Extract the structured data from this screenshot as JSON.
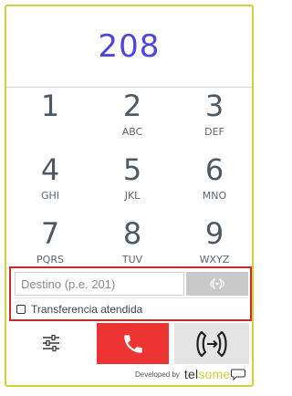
{
  "display": {
    "number": "208"
  },
  "keypad": [
    {
      "digit": "1",
      "letters": ""
    },
    {
      "digit": "2",
      "letters": "ABC"
    },
    {
      "digit": "3",
      "letters": "DEF"
    },
    {
      "digit": "4",
      "letters": "GHI"
    },
    {
      "digit": "5",
      "letters": "JKL"
    },
    {
      "digit": "6",
      "letters": "MNO"
    },
    {
      "digit": "7",
      "letters": "PQRS"
    },
    {
      "digit": "8",
      "letters": "TUV"
    },
    {
      "digit": "9",
      "letters": "WXYZ"
    }
  ],
  "destination": {
    "placeholder": "Destino (p.e. 201)",
    "call_icon": "ringing-phone-icon",
    "attended_label": "Transferencia atendida",
    "attended_checked": false
  },
  "actions": {
    "settings_icon": "sliders-icon",
    "hangup_icon": "phone-icon",
    "transfer_icon": "phone-transfer-icon"
  },
  "footer": {
    "developed_by": "Developed by",
    "brand_part1": "tel",
    "brand_part2": "some"
  },
  "colors": {
    "accent": "#cfd33a",
    "number": "#4d46d9",
    "hangup": "#ee3333",
    "highlight_border": "#c92b2b"
  }
}
